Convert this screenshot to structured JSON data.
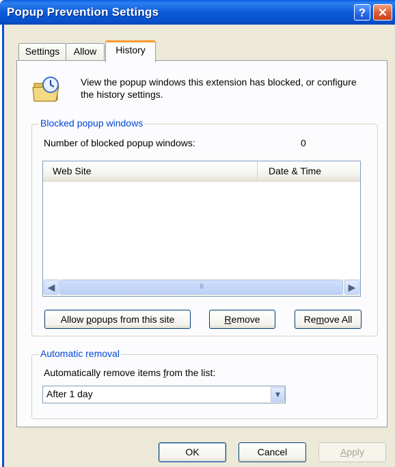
{
  "window": {
    "title": "Popup Prevention Settings",
    "help_glyph": "?",
    "close_glyph": "✕"
  },
  "tabs": [
    {
      "label": "Settings"
    },
    {
      "label": "Allow"
    },
    {
      "label": "History",
      "selected": true
    }
  ],
  "intro": {
    "icon": "folder-history-icon",
    "text": "View the popup windows this extension has blocked, or configure the history settings."
  },
  "blocked": {
    "group_title": "Blocked popup windows",
    "count_label": "Number of blocked popup windows:",
    "count_value": "0",
    "columns": [
      "Web Site",
      "Date & Time"
    ],
    "rows": [],
    "scroll_thumb_grip": "III",
    "buttons": {
      "allow_pre": "Allow ",
      "allow_key": "p",
      "allow_post": "opups from this site",
      "remove_key": "R",
      "remove_post": "emove",
      "removeall_pre": "Re",
      "removeall_key": "m",
      "removeall_post": "ove All"
    }
  },
  "auto_removal": {
    "group_title": "Automatic removal",
    "label_pre": "Automatically remove items ",
    "label_key": "f",
    "label_post": "rom the list:",
    "selected": "After 1 day"
  },
  "footer": {
    "ok": "OK",
    "cancel": "Cancel",
    "apply_key": "A",
    "apply_post": "pply"
  },
  "colors": {
    "title_bar": "#0a5fe0",
    "dialog_bg": "#ece9d8",
    "group_title": "#0046d5",
    "active_tab_accent": "#ff9a2e"
  }
}
